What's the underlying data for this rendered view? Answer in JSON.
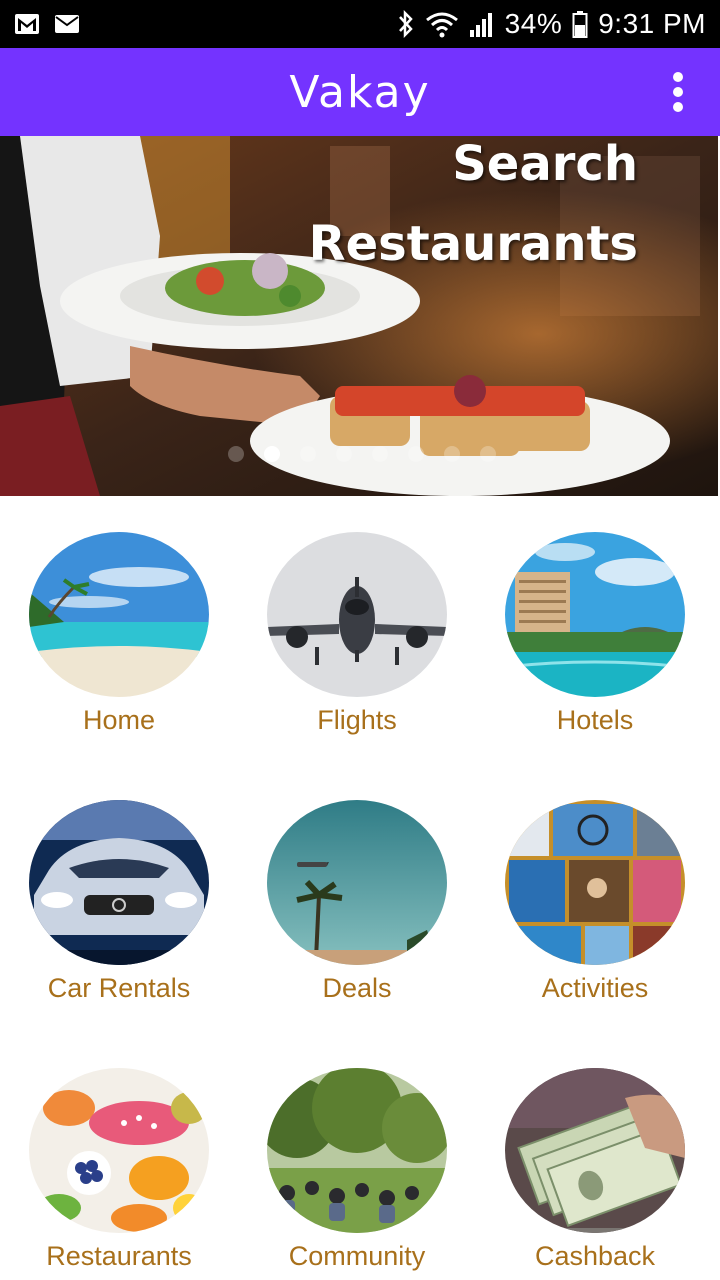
{
  "status_bar": {
    "battery": "34%",
    "time": "9:31 PM",
    "icons": [
      "gmail-icon",
      "mail-icon",
      "bluetooth-icon",
      "wifi-icon",
      "signal-icon",
      "battery-icon"
    ]
  },
  "app_bar": {
    "title": "Vakay",
    "menu_icon": "more-vert-icon"
  },
  "banner": {
    "title_line1": "Search",
    "title_line2": "Restaurants",
    "slide_count": 8,
    "active_slide": 2
  },
  "categories": [
    {
      "label": "Home",
      "icon": "beach-image"
    },
    {
      "label": "Flights",
      "icon": "airplane-image"
    },
    {
      "label": "Hotels",
      "icon": "hotel-image"
    },
    {
      "label": "Car Rentals",
      "icon": "car-image"
    },
    {
      "label": "Deals",
      "icon": "palm-plane-image"
    },
    {
      "label": "Activities",
      "icon": "activities-collage-image"
    },
    {
      "label": "Restaurants",
      "icon": "fruit-bowl-image"
    },
    {
      "label": "Community",
      "icon": "park-crowd-image"
    },
    {
      "label": "Cashback",
      "icon": "money-image"
    }
  ],
  "colors": {
    "app_bar": "#7433ff",
    "label": "#a8701b",
    "status_bar": "#000000"
  }
}
